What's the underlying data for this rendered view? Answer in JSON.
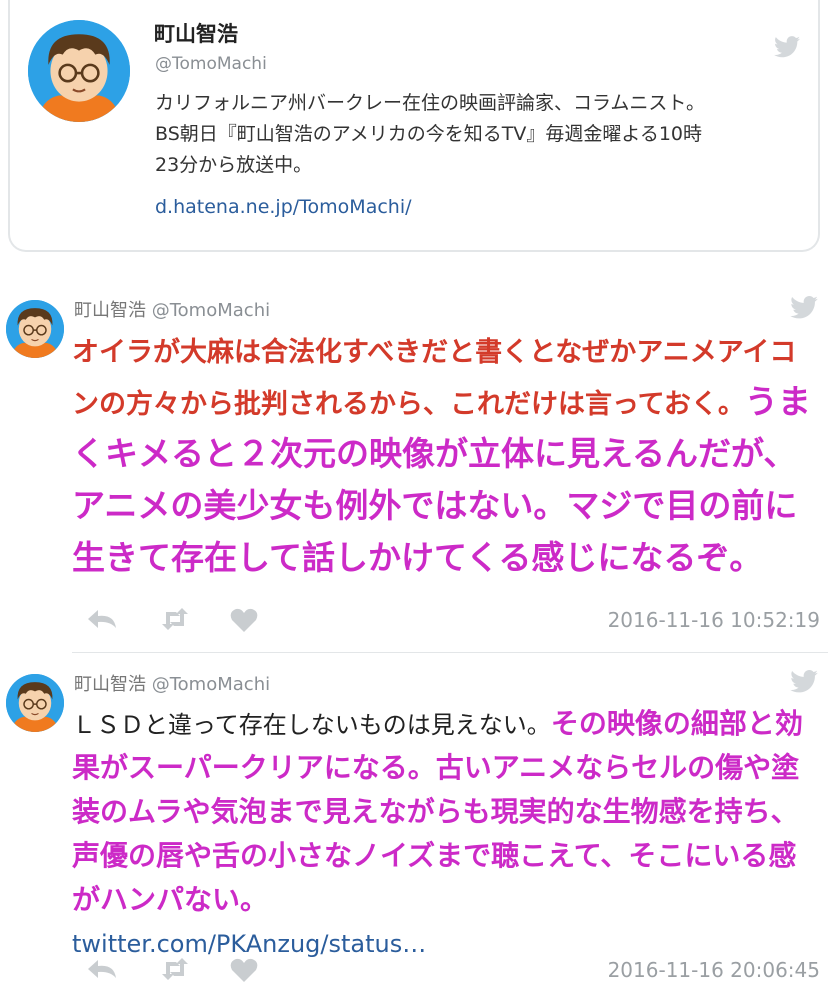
{
  "profile": {
    "name": "町山智浩",
    "handle": "@TomoMachi",
    "bio_lines": [
      "カリフォルニア州バークレー在住の映画評論家、コラムニスト。",
      "BS朝日『町山智浩のアメリカの今を知るTV』毎週金曜よる10時",
      "23分から放送中。"
    ],
    "link": "d.hatena.ne.jp/TomoMachi/"
  },
  "tweets": [
    {
      "name": "町山智浩",
      "handle": "@TomoMachi",
      "text_red": "オイラが大麻は合法化すべきだと書くとなぜかアニメアイコンの方々から批判されるから、これだけは言っておく。",
      "text_magenta": "うまくキメると２次元の映像が立体に見えるんだが、アニメの美少女も例外ではない。マジで目の前に生きて存在して話しかけてくる感じになるぞ。",
      "timestamp": "2016-11-16 10:52:19"
    },
    {
      "name": "町山智浩",
      "handle": "@TomoMachi",
      "text_plain": "ＬＳＤと違って存在しないものは見えない。",
      "text_magenta": "その映像の細部と効果がスーパークリアになる。古いアニメならセルの傷や塗装のムラや気泡まで見えながらも現実的な生物感を持ち、声優の唇や舌の小さなノイズまで聴こえて、そこにいる感がハンパない。",
      "link": "twitter.com/PKAnzug/status…",
      "timestamp": "2016-11-16 20:06:45"
    }
  ],
  "colors": {
    "red_text": "#d33a2a",
    "magenta_text": "#cc2ac7",
    "link": "#2b5d9c",
    "avatar_bg": "#2da1e6"
  },
  "icons": [
    "twitter-bird-icon",
    "reply-icon",
    "retweet-icon",
    "like-icon"
  ]
}
